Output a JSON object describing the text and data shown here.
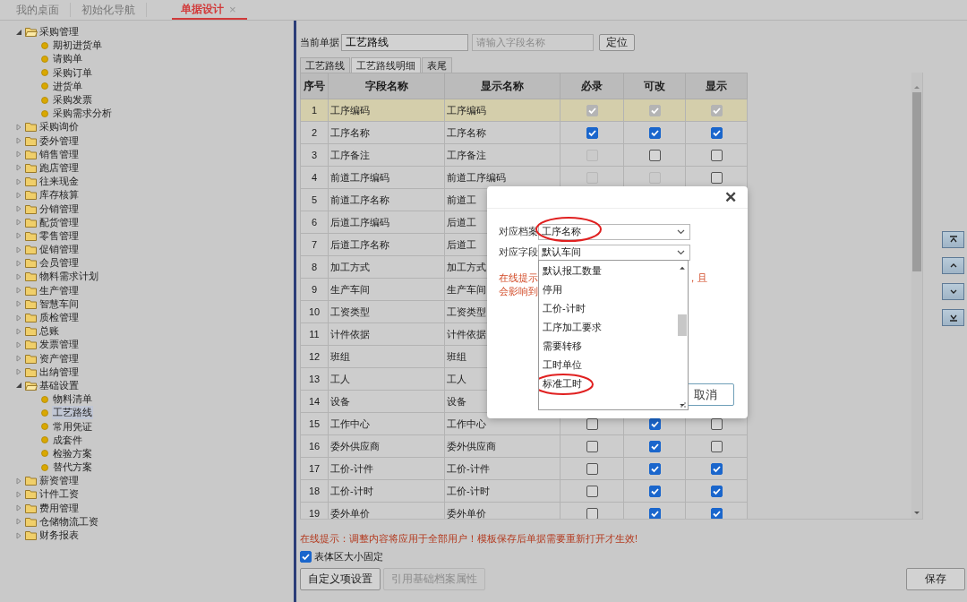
{
  "top_tabs": [
    {
      "label": "我的桌面",
      "selected": false,
      "closable": false
    },
    {
      "label": "初始化导航",
      "selected": false,
      "closable": false
    },
    {
      "label": "单据设计",
      "selected": true,
      "closable": true,
      "close": "×"
    }
  ],
  "tree": [
    {
      "label": "采购管理",
      "expanded": true,
      "children": [
        {
          "label": "期初进货单",
          "selected": false
        },
        {
          "label": "请购单",
          "selected": false
        },
        {
          "label": "采购订单",
          "selected": false
        },
        {
          "label": "进货单",
          "selected": false
        },
        {
          "label": "采购发票",
          "selected": false
        },
        {
          "label": "采购需求分析",
          "selected": false
        }
      ]
    },
    {
      "label": "采购询价",
      "expanded": false
    },
    {
      "label": "委外管理",
      "expanded": false
    },
    {
      "label": "销售管理",
      "expanded": false
    },
    {
      "label": "跑店管理",
      "expanded": false
    },
    {
      "label": "往来现金",
      "expanded": false
    },
    {
      "label": "库存核算",
      "expanded": false
    },
    {
      "label": "分销管理",
      "expanded": false
    },
    {
      "label": "配货管理",
      "expanded": false
    },
    {
      "label": "零售管理",
      "expanded": false
    },
    {
      "label": "促销管理",
      "expanded": false
    },
    {
      "label": "会员管理",
      "expanded": false
    },
    {
      "label": "物料需求计划",
      "expanded": false
    },
    {
      "label": "生产管理",
      "expanded": false
    },
    {
      "label": "智慧车间",
      "expanded": false
    },
    {
      "label": "质检管理",
      "expanded": false
    },
    {
      "label": "总账",
      "expanded": false
    },
    {
      "label": "发票管理",
      "expanded": false
    },
    {
      "label": "资产管理",
      "expanded": false
    },
    {
      "label": "出纳管理",
      "expanded": false
    },
    {
      "label": "基础设置",
      "expanded": true,
      "children": [
        {
          "label": "物料清单",
          "selected": false
        },
        {
          "label": "工艺路线",
          "selected": true
        },
        {
          "label": "常用凭证",
          "selected": false
        },
        {
          "label": "成套件",
          "selected": false
        },
        {
          "label": "检验方案",
          "selected": false
        },
        {
          "label": "替代方案",
          "selected": false
        }
      ]
    },
    {
      "label": "薪资管理",
      "expanded": false
    },
    {
      "label": "计件工资",
      "expanded": false
    },
    {
      "label": "费用管理",
      "expanded": false
    },
    {
      "label": "仓储物流工资",
      "expanded": false
    },
    {
      "label": "财务报表",
      "expanded": false
    }
  ],
  "current_doc": {
    "label": "当前单据",
    "value": "工艺路线",
    "search_placeholder": "请输入字段名称",
    "locate_button": "定位"
  },
  "sub_tabs": [
    {
      "label": "工艺路线",
      "selected": false
    },
    {
      "label": "工艺路线明细",
      "selected": true
    },
    {
      "label": "表尾",
      "selected": false
    }
  ],
  "table": {
    "columns": [
      "序号",
      "字段名称",
      "显示名称",
      "必录",
      "可改",
      "显示"
    ],
    "rows": [
      {
        "no": "1",
        "field": "工序编码",
        "display": "工序编码",
        "selected": true,
        "checks": [
          {
            "checked": true,
            "disabled": true
          },
          {
            "checked": true,
            "disabled": true
          },
          {
            "checked": true,
            "disabled": true
          }
        ]
      },
      {
        "no": "2",
        "field": "工序名称",
        "display": "工序名称",
        "selected": false,
        "checks": [
          {
            "checked": true,
            "disabled": false
          },
          {
            "checked": true,
            "disabled": false
          },
          {
            "checked": true,
            "disabled": false
          }
        ]
      },
      {
        "no": "3",
        "field": "工序备注",
        "display": "工序备注",
        "selected": false,
        "checks": [
          {
            "checked": false,
            "disabled": true
          },
          {
            "checked": false,
            "disabled": false
          },
          {
            "checked": false,
            "disabled": false
          }
        ]
      },
      {
        "no": "4",
        "field": "前道工序编码",
        "display": "前道工序编码",
        "selected": false,
        "checks": [
          {
            "checked": false,
            "disabled": true
          },
          {
            "checked": false,
            "disabled": true
          },
          {
            "checked": false,
            "disabled": false
          }
        ]
      },
      {
        "no": "5",
        "field": "前道工序名称",
        "display": "前道工",
        "selected": false
      },
      {
        "no": "6",
        "field": "后道工序编码",
        "display": "后道工",
        "selected": false
      },
      {
        "no": "7",
        "field": "后道工序名称",
        "display": "后道工",
        "selected": false
      },
      {
        "no": "8",
        "field": "加工方式",
        "display": "加工方式",
        "selected": false
      },
      {
        "no": "9",
        "field": "生产车间",
        "display": "生产车间",
        "selected": false
      },
      {
        "no": "10",
        "field": "工资类型",
        "display": "工资类型",
        "selected": false
      },
      {
        "no": "11",
        "field": "计件依据",
        "display": "计件依据",
        "selected": false
      },
      {
        "no": "12",
        "field": "班组",
        "display": "班组",
        "selected": false
      },
      {
        "no": "13",
        "field": "工人",
        "display": "工人",
        "selected": false
      },
      {
        "no": "14",
        "field": "设备",
        "display": "设备",
        "selected": false
      },
      {
        "no": "15",
        "field": "工作中心",
        "display": "工作中心",
        "selected": false,
        "checks": [
          {
            "checked": false,
            "disabled": false
          },
          {
            "checked": true,
            "disabled": false
          },
          {
            "checked": false,
            "disabled": false
          }
        ]
      },
      {
        "no": "16",
        "field": "委外供应商",
        "display": "委外供应商",
        "selected": false,
        "checks": [
          {
            "checked": false,
            "disabled": false
          },
          {
            "checked": true,
            "disabled": false
          },
          {
            "checked": false,
            "disabled": false
          }
        ]
      },
      {
        "no": "17",
        "field": "工价-计件",
        "display": "工价-计件",
        "selected": false,
        "checks": [
          {
            "checked": false,
            "disabled": false
          },
          {
            "checked": true,
            "disabled": false
          },
          {
            "checked": true,
            "disabled": false
          }
        ]
      },
      {
        "no": "18",
        "field": "工价-计时",
        "display": "工价-计时",
        "selected": false,
        "checks": [
          {
            "checked": false,
            "disabled": false
          },
          {
            "checked": true,
            "disabled": false
          },
          {
            "checked": true,
            "disabled": false
          }
        ]
      },
      {
        "no": "19",
        "field": "委外单价",
        "display": "委外单价",
        "selected": false,
        "checks": [
          {
            "checked": false,
            "disabled": false
          },
          {
            "checked": true,
            "disabled": false
          },
          {
            "checked": true,
            "disabled": false
          }
        ]
      }
    ]
  },
  "move_buttons": [
    {
      "kind": "top"
    },
    {
      "kind": "up"
    },
    {
      "kind": "down"
    },
    {
      "kind": "bottom"
    }
  ],
  "hint": "在线提示：调整内容将应用于全部用户！模板保存后单据需要重新打开才生效!",
  "fixed_size": {
    "label": "表体区大小固定",
    "checked": true
  },
  "buttons": [
    {
      "label": "自定义项设置",
      "disabled": false
    },
    {
      "label": "引用基础档案属性",
      "disabled": true
    }
  ],
  "save_button": "保存",
  "dialog": {
    "close": "✕",
    "archive": {
      "label": "对应档案",
      "value": "工序名称",
      "circled": true
    },
    "field": {
      "label": "对应字段",
      "value": "默认车间"
    },
    "hint_parts": [
      [
        "在线提示",
        "，且"
      ],
      [
        "会影响到"
      ]
    ],
    "options": [
      {
        "label": "默认报工数量",
        "circled": false
      },
      {
        "label": "停用",
        "circled": false
      },
      {
        "label": "工价-计时",
        "circled": false
      },
      {
        "label": "工序加工要求",
        "circled": false
      },
      {
        "label": "需要转移",
        "circled": false
      },
      {
        "label": "工时单位",
        "circled": false
      },
      {
        "label": "标准工时",
        "circled": true
      }
    ],
    "cancel_button": "取消"
  }
}
